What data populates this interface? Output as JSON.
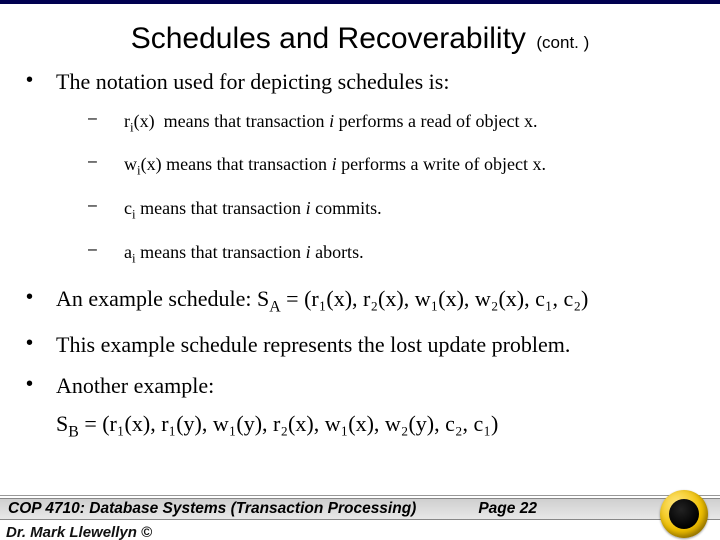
{
  "title": {
    "main": "Schedules and Recoverability",
    "cont": "(cont. )"
  },
  "intro": "The notation used for depicting schedules is:",
  "notation": {
    "read": {
      "sym_base": "r",
      "sym_sub": "i",
      "sym_arg": "(x)",
      "verb": "means that transaction",
      "obj": "performs a read of object x."
    },
    "write": {
      "sym_base": "w",
      "sym_sub": "i",
      "sym_arg": "(x)",
      "verb": "means that transaction",
      "obj": "performs a write of object x."
    },
    "commit": {
      "sym_base": "c",
      "sym_sub": "i",
      "sym_arg": "",
      "verb": "means that transaction",
      "obj": "commits."
    },
    "abort": {
      "sym_base": "a",
      "sym_sub": "i",
      "sym_arg": "",
      "verb": "means that transaction",
      "obj": "aborts."
    },
    "i": "i"
  },
  "example": {
    "lead": "An example schedule: S",
    "sub": "A",
    "body": " = (r₁(x), r₂(x), w₁(x), w₂(x), c₁, c₂)"
  },
  "lost_update": "This example schedule represents the lost update problem.",
  "another": "Another example:",
  "example2": {
    "lead": "S",
    "sub": "B",
    "body": " = (r₁(x), r₁(y), w₁(y), r₂(x), w₁(x), w₂(y), c₂, c₁)"
  },
  "footer": {
    "course": "COP 4710: Database Systems  (Transaction Processing)",
    "page": "Page 22",
    "author": "Dr. Mark Llewellyn ©"
  }
}
